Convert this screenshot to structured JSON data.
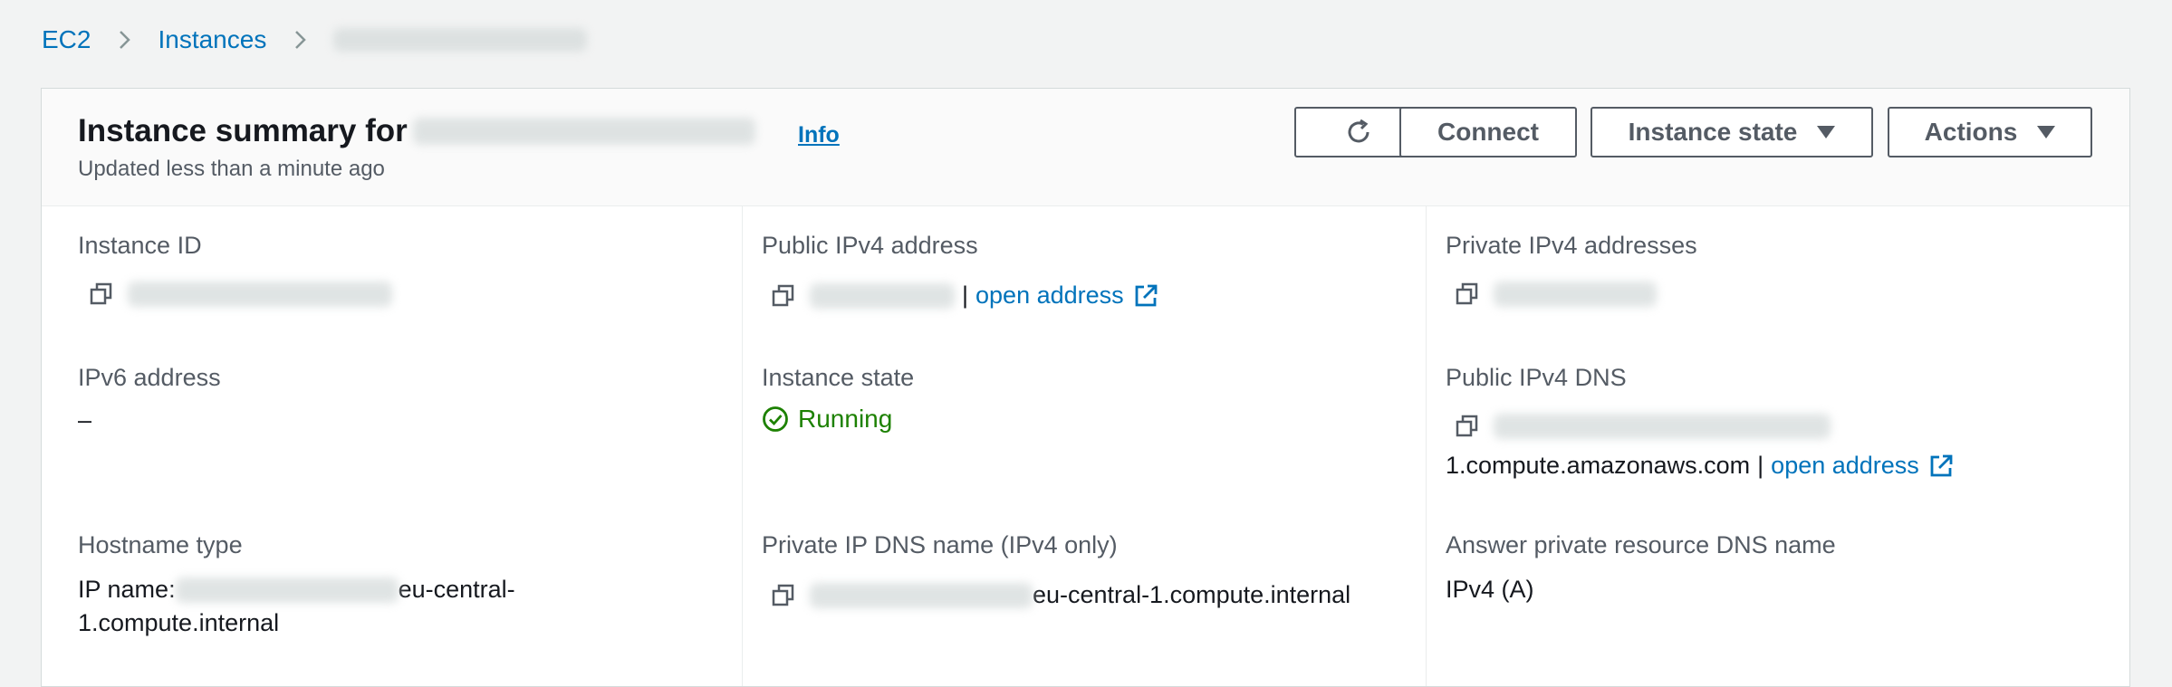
{
  "breadcrumb": {
    "items": [
      "EC2",
      "Instances"
    ],
    "current_redacted": ""
  },
  "header": {
    "title_prefix": "Instance summary for",
    "info_label": "Info",
    "updated": "Updated less than a minute ago",
    "buttons": {
      "refresh_icon": "refresh-icon",
      "connect": "Connect",
      "instance_state": "Instance state",
      "actions": "Actions"
    }
  },
  "details": {
    "instance_id": {
      "label": "Instance ID"
    },
    "public_ipv4": {
      "label": "Public IPv4 address",
      "separator": "|",
      "link": "open address"
    },
    "private_ipv4": {
      "label": "Private IPv4 addresses"
    },
    "ipv6": {
      "label": "IPv6 address",
      "value": "–"
    },
    "instance_state": {
      "label": "Instance state",
      "value": "Running"
    },
    "public_dns": {
      "label": "Public IPv4 DNS",
      "suffix": "1.compute.amazonaws.com",
      "separator": "|",
      "link": "open address"
    },
    "hostname_type": {
      "label": "Hostname type",
      "prefix": "IP name:",
      "suffix_line1": "eu-central-",
      "line2": "1.compute.internal"
    },
    "private_dns": {
      "label": "Private IP DNS name (IPv4 only)",
      "suffix": "eu-central-1.compute.internal"
    },
    "answer_dns": {
      "label": "Answer private resource DNS name",
      "value": "IPv4 (A)"
    }
  },
  "colors": {
    "link": "#0073bb",
    "success": "#1d8102",
    "text": "#16191f",
    "muted": "#545b64"
  }
}
